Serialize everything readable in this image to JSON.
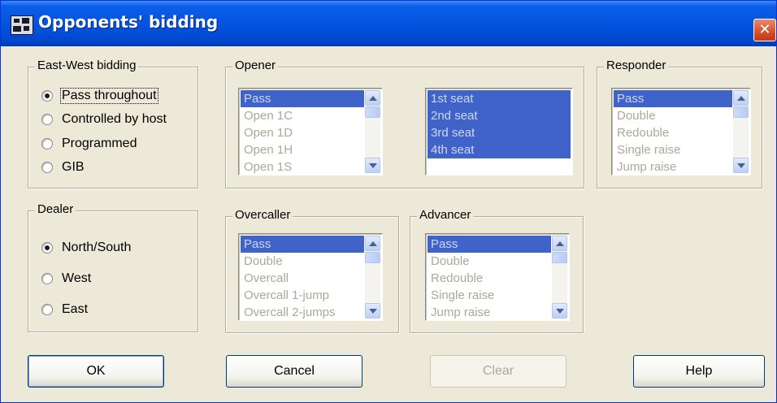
{
  "window": {
    "title": "Opponents' bidding",
    "close_glyph": "✕",
    "app_icon": "bridge-app-icon"
  },
  "ew_bidding": {
    "label": "East-West bidding",
    "options": [
      "Pass throughout",
      "Controlled by host",
      "Programmed",
      "GIB"
    ],
    "selected": 0
  },
  "dealer": {
    "label": "Dealer",
    "options": [
      "North/South",
      "West",
      "East"
    ],
    "selected": 0
  },
  "opener": {
    "label": "Opener",
    "bids": [
      "Pass",
      "Open 1C",
      "Open 1D",
      "Open 1H",
      "Open 1S"
    ],
    "seats": [
      "1st seat",
      "2nd seat",
      "3rd seat",
      "4th seat"
    ]
  },
  "responder": {
    "label": "Responder",
    "bids": [
      "Pass",
      "Double",
      "Redouble",
      "Single raise",
      "Jump raise"
    ]
  },
  "overcaller": {
    "label": "Overcaller",
    "bids": [
      "Pass",
      "Double",
      "Overcall",
      "Overcall 1-jump",
      "Overcall 2-jumps"
    ]
  },
  "advancer": {
    "label": "Advancer",
    "bids": [
      "Pass",
      "Double",
      "Redouble",
      "Single raise",
      "Jump raise"
    ]
  },
  "buttons": {
    "ok": "OK",
    "cancel": "Cancel",
    "clear": "Clear",
    "help": "Help"
  },
  "colors": {
    "titlebar": "#0354e0",
    "close": "#d4512d",
    "selection": "#3f63c8",
    "dialog": "#ece9d8"
  }
}
